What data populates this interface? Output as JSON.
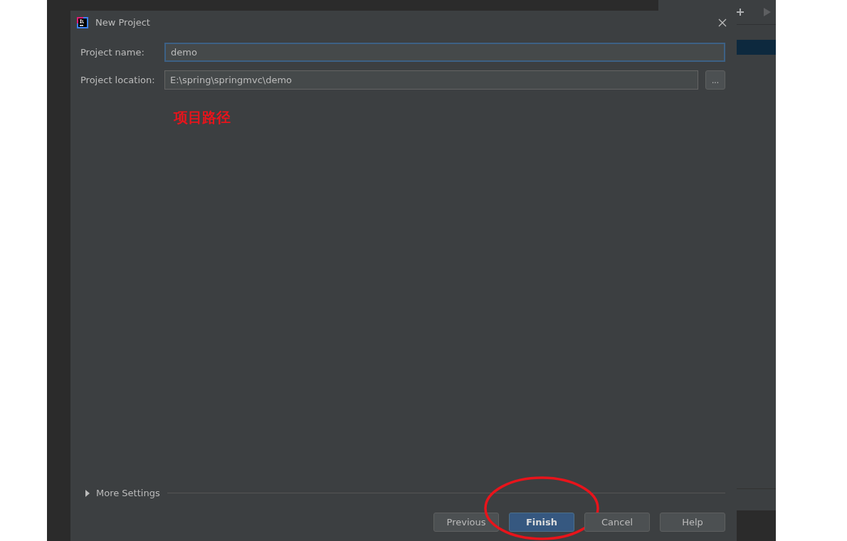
{
  "dialog": {
    "title": "New Project",
    "fields": [
      {
        "label": "Project name:",
        "value": "demo",
        "focused": true
      },
      {
        "label": "Project location:",
        "value": "E:\\spring\\springmvc\\demo",
        "focused": false
      }
    ],
    "browse_button": "...",
    "annotation": "项目路径",
    "more_settings": {
      "label": "More Settings",
      "expanded": false
    },
    "buttons": [
      {
        "label": "Previous",
        "default": false,
        "circled": false
      },
      {
        "label": "Finish",
        "default": true,
        "circled": true
      },
      {
        "label": "Cancel",
        "default": false,
        "circled": false
      },
      {
        "label": "Help",
        "default": false,
        "circled": false
      }
    ]
  }
}
